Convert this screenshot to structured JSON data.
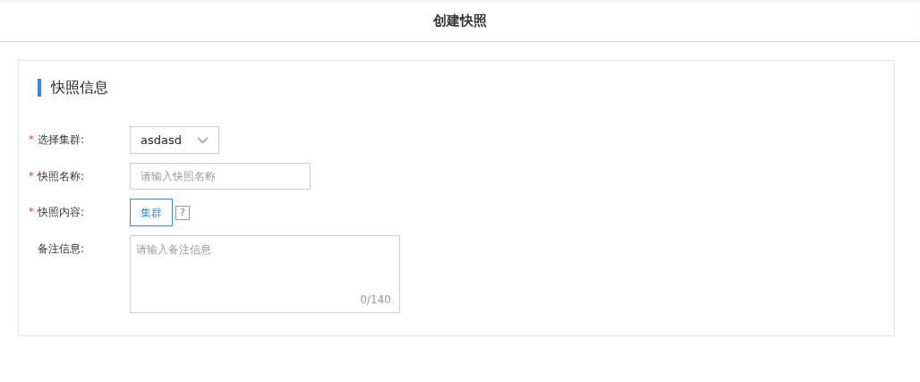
{
  "header": {
    "title": "创建快照"
  },
  "section": {
    "title": "快照信息"
  },
  "fields": [
    {
      "kind": "select",
      "required_mark": "*",
      "label": "选择集群:",
      "value": "asdasd"
    },
    {
      "kind": "input",
      "required_mark": "*",
      "label": "快照名称:",
      "placeholder": "请输入快照名称"
    },
    {
      "kind": "toggle",
      "required_mark": "*",
      "label": "快照内容:",
      "option": {
        "label": "集群",
        "selected": true
      },
      "help_icon": "?"
    },
    {
      "kind": "textarea",
      "label": "备注信息:",
      "placeholder": "请输入备注信息",
      "counter": "0/140"
    }
  ]
}
